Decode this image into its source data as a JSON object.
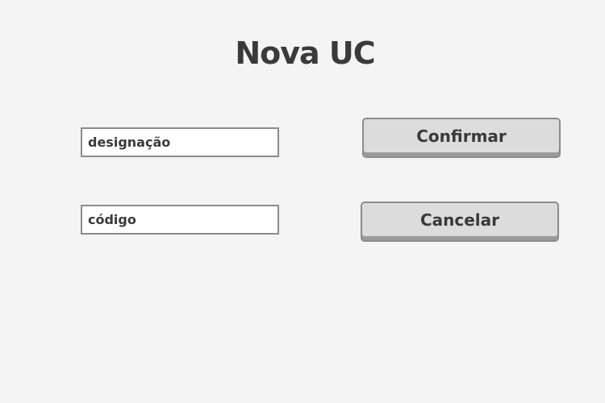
{
  "page": {
    "title": "Nova UC"
  },
  "form": {
    "designacao_placeholder": "designação",
    "designacao_value": "",
    "codigo_placeholder": "código",
    "codigo_value": ""
  },
  "actions": {
    "confirm_label": "Confirmar",
    "cancel_label": "Cancelar"
  },
  "colors": {
    "background": "#f4f4f4",
    "text": "#3a3a3a",
    "border": "#8c8c8c",
    "button_face": "#dcdcdc"
  }
}
